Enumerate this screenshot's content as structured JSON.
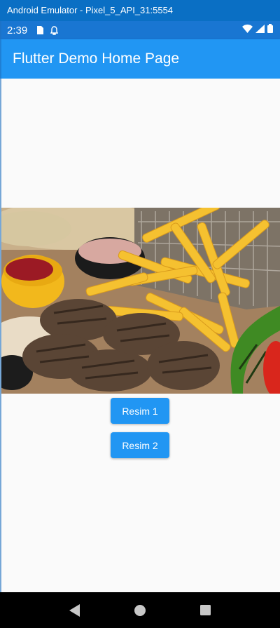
{
  "window": {
    "title": "Android Emulator - Pixel_5_API_31:5554"
  },
  "statusbar": {
    "time": "2:39"
  },
  "appbar": {
    "title": "Flutter Demo Home Page"
  },
  "buttons": {
    "resim1": "Resim 1",
    "resim2": "Resim 2"
  },
  "colors": {
    "appbar": "#2196f3",
    "statusbar": "#1976d2",
    "window_title": "#0a6fc4",
    "button": "#2196f3"
  },
  "icons": {
    "statusbar_left": [
      "sim-card-icon",
      "notification-icon"
    ],
    "statusbar_right": [
      "wifi-icon",
      "signal-icon",
      "battery-icon"
    ],
    "navbar": [
      "back-icon",
      "home-icon",
      "recents-icon"
    ]
  }
}
